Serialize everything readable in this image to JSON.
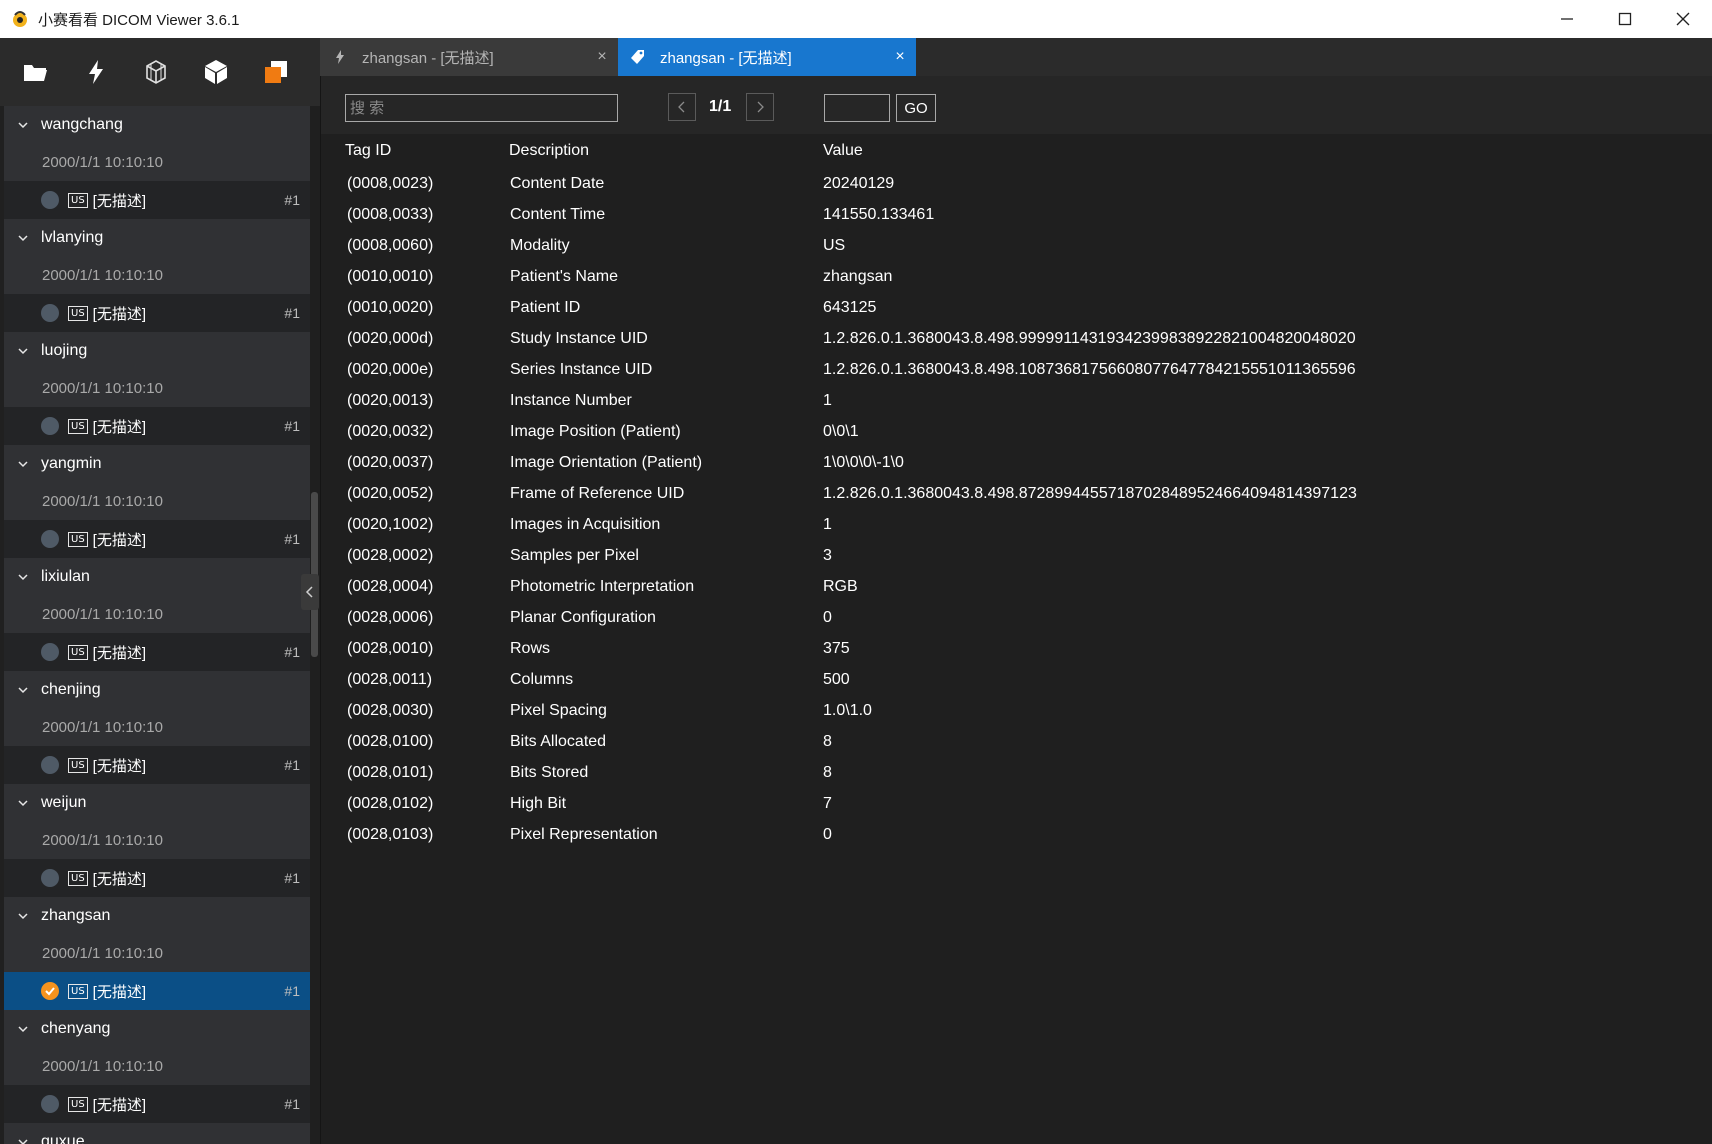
{
  "window": {
    "title": "小赛看看 DICOM Viewer 3.6.1"
  },
  "toolbar": {
    "tools": [
      "folder-open-icon",
      "lightning-icon",
      "cube-wireframe-icon",
      "cube-solid-icon",
      "layers-orange-icon"
    ]
  },
  "sidebar": {
    "groups": [
      {
        "name": "wangchang",
        "date": "2000/1/1 10:10:10",
        "modality": "US",
        "desc": "[无描述]",
        "num": "#1",
        "selected": false
      },
      {
        "name": "lvlanying",
        "date": "2000/1/1 10:10:10",
        "modality": "US",
        "desc": "[无描述]",
        "num": "#1",
        "selected": false
      },
      {
        "name": "luojing",
        "date": "2000/1/1 10:10:10",
        "modality": "US",
        "desc": "[无描述]",
        "num": "#1",
        "selected": false
      },
      {
        "name": "yangmin",
        "date": "2000/1/1 10:10:10",
        "modality": "US",
        "desc": "[无描述]",
        "num": "#1",
        "selected": false
      },
      {
        "name": "lixiulan",
        "date": "2000/1/1 10:10:10",
        "modality": "US",
        "desc": "[无描述]",
        "num": "#1",
        "selected": false
      },
      {
        "name": "chenjing",
        "date": "2000/1/1 10:10:10",
        "modality": "US",
        "desc": "[无描述]",
        "num": "#1",
        "selected": false
      },
      {
        "name": "weijun",
        "date": "2000/1/1 10:10:10",
        "modality": "US",
        "desc": "[无描述]",
        "num": "#1",
        "selected": false
      },
      {
        "name": "zhangsan",
        "date": "2000/1/1 10:10:10",
        "modality": "US",
        "desc": "[无描述]",
        "num": "#1",
        "selected": true
      },
      {
        "name": "chenyang",
        "date": "2000/1/1 10:10:10",
        "modality": "US",
        "desc": "[无描述]",
        "num": "#1",
        "selected": false
      },
      {
        "name": "guxue",
        "date": "",
        "modality": "",
        "desc": "",
        "num": "",
        "selected": false
      }
    ]
  },
  "tabs": [
    {
      "label": "zhangsan - [无描述]",
      "close": "×",
      "active": false
    },
    {
      "label": "zhangsan - [无描述]",
      "close": "×",
      "active": true
    }
  ],
  "search": {
    "placeholder": "搜 索",
    "page_indicator": "1/1",
    "go_label": "GO"
  },
  "table": {
    "headers": [
      "Tag ID",
      "Description",
      "Value"
    ],
    "rows": [
      [
        "(0008,0023)",
        "Content Date",
        "20240129"
      ],
      [
        "(0008,0033)",
        "Content Time",
        "141550.133461"
      ],
      [
        "(0008,0060)",
        "Modality",
        "US"
      ],
      [
        "(0010,0010)",
        "Patient's Name",
        "zhangsan"
      ],
      [
        "(0010,0020)",
        "Patient ID",
        "643125"
      ],
      [
        "(0020,000d)",
        "Study Instance UID",
        "1.2.826.0.1.3680043.8.498.99999114319342399838922821004820048020"
      ],
      [
        "(0020,000e)",
        "Series Instance UID",
        "1.2.826.0.1.3680043.8.498.10873681756608077647784215551011365596"
      ],
      [
        "(0020,0013)",
        "Instance Number",
        "1"
      ],
      [
        "(0020,0032)",
        "Image Position (Patient)",
        "0\\0\\1"
      ],
      [
        "(0020,0037)",
        "Image Orientation (Patient)",
        "1\\0\\0\\0\\-1\\0"
      ],
      [
        "(0020,0052)",
        "Frame of Reference UID",
        "1.2.826.0.1.3680043.8.498.87289944557187028489524664094814397123"
      ],
      [
        "(0020,1002)",
        "Images in Acquisition",
        "1"
      ],
      [
        "(0028,0002)",
        "Samples per Pixel",
        "3"
      ],
      [
        "(0028,0004)",
        "Photometric Interpretation",
        "RGB"
      ],
      [
        "(0028,0006)",
        "Planar Configuration",
        "0"
      ],
      [
        "(0028,0010)",
        "Rows",
        "375"
      ],
      [
        "(0028,0011)",
        "Columns",
        "500"
      ],
      [
        "(0028,0030)",
        "Pixel Spacing",
        "1.0\\1.0"
      ],
      [
        "(0028,0100)",
        "Bits Allocated",
        "8"
      ],
      [
        "(0028,0101)",
        "Bits Stored",
        "8"
      ],
      [
        "(0028,0102)",
        "High Bit",
        "7"
      ],
      [
        "(0028,0103)",
        "Pixel Representation",
        "0"
      ]
    ]
  },
  "colors": {
    "accent": "#1877cf",
    "selected_row": "#0b4f86",
    "check_orange": "#f5931e"
  }
}
